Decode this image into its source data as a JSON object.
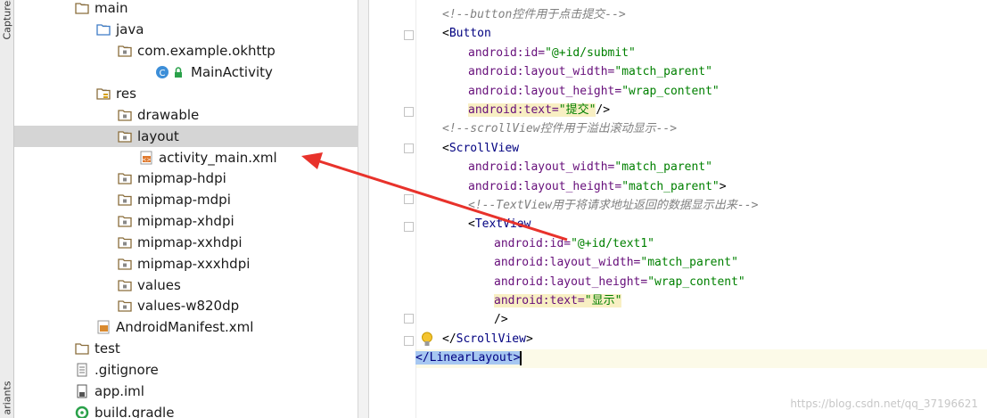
{
  "side_strip": {
    "top_label": "Captures",
    "bottom_label": "ariants"
  },
  "tree": {
    "items": [
      {
        "label": "main",
        "icon": "folder-icon",
        "expanded": true
      },
      {
        "label": "java",
        "icon": "source-folder-icon",
        "expanded": true
      },
      {
        "label": "com.example.okhttp",
        "icon": "package-icon",
        "expanded": true
      },
      {
        "label": "MainActivity",
        "icon": "class-icon"
      },
      {
        "label": "res",
        "icon": "resource-folder-icon",
        "expanded": true
      },
      {
        "label": "drawable",
        "icon": "package-icon"
      },
      {
        "label": "layout",
        "icon": "package-icon",
        "expanded": true,
        "selected": true
      },
      {
        "label": "activity_main.xml",
        "icon": "xml-layout-file-icon"
      },
      {
        "label": "mipmap-hdpi",
        "icon": "package-icon",
        "expanded": false
      },
      {
        "label": "mipmap-mdpi",
        "icon": "package-icon",
        "expanded": false
      },
      {
        "label": "mipmap-xhdpi",
        "icon": "package-icon",
        "expanded": false
      },
      {
        "label": "mipmap-xxhdpi",
        "icon": "package-icon",
        "expanded": false
      },
      {
        "label": "mipmap-xxxhdpi",
        "icon": "package-icon",
        "expanded": false
      },
      {
        "label": "values",
        "icon": "package-icon",
        "expanded": false
      },
      {
        "label": "values-w820dp",
        "icon": "package-icon",
        "expanded": false
      },
      {
        "label": "AndroidManifest.xml",
        "icon": "manifest-file-icon"
      },
      {
        "label": "test",
        "icon": "folder-icon",
        "expanded": false
      },
      {
        "label": ".gitignore",
        "icon": "text-file-icon"
      },
      {
        "label": "app.iml",
        "icon": "iml-file-icon"
      },
      {
        "label": "build.gradle",
        "icon": "gradle-file-icon"
      }
    ]
  },
  "editor": {
    "lines": [
      [
        {
          "t": "<!--button控件用于点击提交-->",
          "c": "cm"
        }
      ],
      [
        {
          "t": "<",
          "c": "br"
        },
        {
          "t": "Button",
          "c": "tg"
        }
      ],
      [
        {
          "t": "android:id=",
          "c": "at"
        },
        {
          "t": "\"@+id/submit\"",
          "c": "st"
        }
      ],
      [
        {
          "t": "android:layout_width=",
          "c": "at"
        },
        {
          "t": "\"match_parent\"",
          "c": "st"
        }
      ],
      [
        {
          "t": "android:layout_height=",
          "c": "at"
        },
        {
          "t": "\"wrap_content\"",
          "c": "st"
        }
      ],
      [
        {
          "t": "android:text=",
          "c": "at hl"
        },
        {
          "t": "\"提交\"",
          "c": "st hl"
        },
        {
          "t": "/>",
          "c": "br"
        }
      ],
      [
        {
          "t": "<!--scrollView控件用于溢出滚动显示-->",
          "c": "cm"
        }
      ],
      [
        {
          "t": "<",
          "c": "br"
        },
        {
          "t": "ScrollView",
          "c": "tg"
        }
      ],
      [
        {
          "t": "android:layout_width=",
          "c": "at"
        },
        {
          "t": "\"match_parent\"",
          "c": "st"
        }
      ],
      [
        {
          "t": "android:layout_height=",
          "c": "at"
        },
        {
          "t": "\"match_parent\"",
          "c": "st"
        },
        {
          "t": ">",
          "c": "br"
        }
      ],
      [
        {
          "t": "<!--TextView用于将请求地址返回的数据显示出来-->",
          "c": "cm"
        }
      ],
      [
        {
          "t": "<",
          "c": "br"
        },
        {
          "t": "TextView",
          "c": "tg"
        }
      ],
      [
        {
          "t": "android:id=",
          "c": "at"
        },
        {
          "t": "\"@+id/text1\"",
          "c": "st"
        }
      ],
      [
        {
          "t": "android:layout_width=",
          "c": "at"
        },
        {
          "t": "\"match_parent\"",
          "c": "st"
        }
      ],
      [
        {
          "t": "android:layout_height=",
          "c": "at"
        },
        {
          "t": "\"wrap_content\"",
          "c": "st"
        }
      ],
      [
        {
          "t": "android:text=",
          "c": "at hl"
        },
        {
          "t": "\"显示\"",
          "c": "st hl"
        }
      ],
      [
        {
          "t": "/>",
          "c": "br"
        }
      ],
      [
        {
          "t": "</",
          "c": "br"
        },
        {
          "t": "ScrollView",
          "c": "tg"
        },
        {
          "t": ">",
          "c": "br"
        }
      ],
      [
        {
          "t": "</",
          "c": "tg selx"
        },
        {
          "t": "LinearLayout",
          "c": "tg selx"
        },
        {
          "t": ">",
          "c": "tg selx"
        }
      ]
    ]
  },
  "watermark": "https://blog.csdn.net/qq_37196621",
  "colors": {
    "annotation_arrow": "#e8322b",
    "selection_row": "#d5d5d5"
  }
}
